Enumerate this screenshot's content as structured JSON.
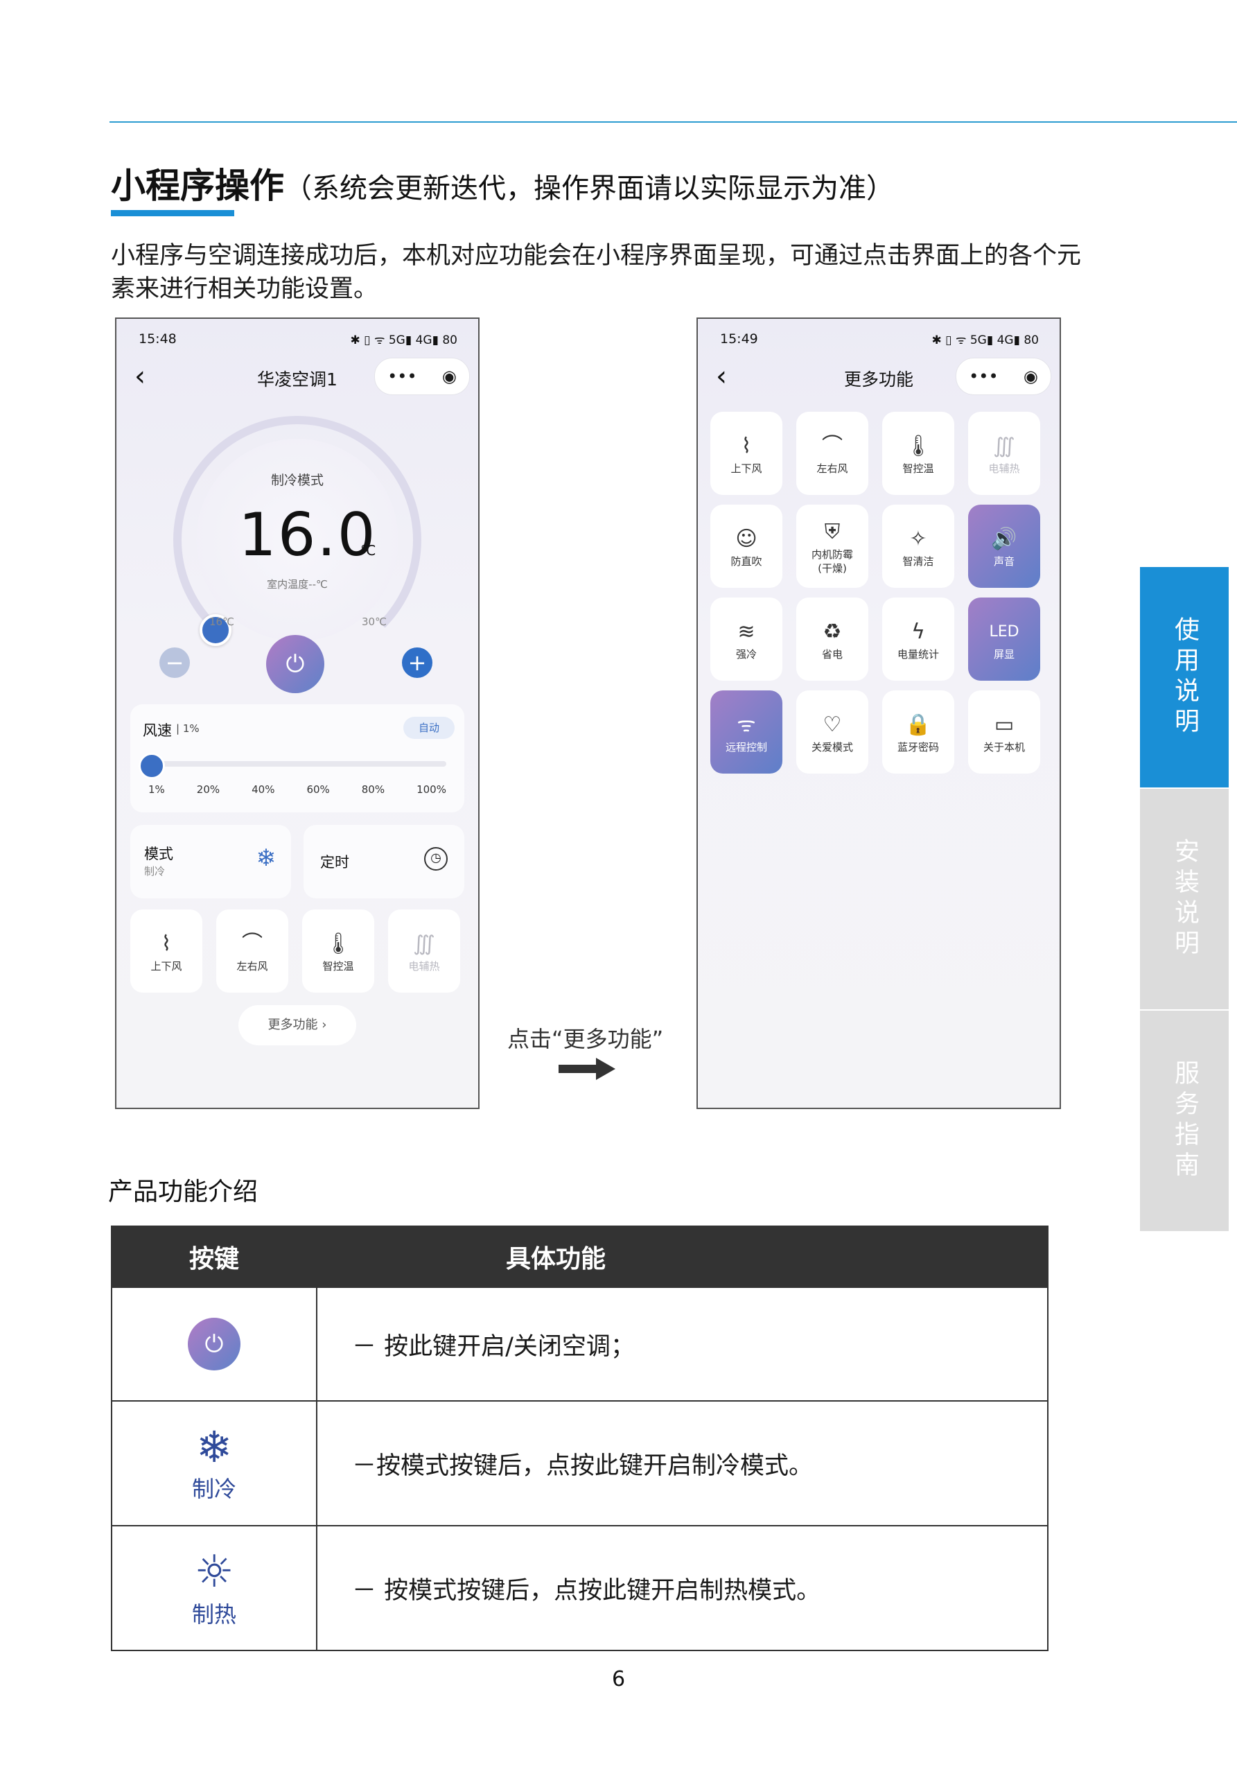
{
  "header": {
    "title": "小程序操作",
    "title_paren_open": "（",
    "title_sub": "系统会更新迭代，操作界面请以实际显示为准",
    "title_paren_close": "）",
    "intro": "小程序与空调连接成功后，本机对应功能会在小程序界面呈现，可通过点击界面上的各个元素来进行相关功能设置。"
  },
  "phone1": {
    "time": "15:48",
    "status_right": "✱ ▯ ᯤ 5G▮ 4G▮ 80",
    "nav_title": "华凌空调1",
    "capsule_more": "•••",
    "capsule_close": "◉",
    "mode_label": "制冷模式",
    "temp_value": "16.0",
    "temp_unit": "℃",
    "indoor_temp": "室内温度--℃",
    "range_min": "16℃",
    "range_max": "30℃",
    "fan_label": "风速",
    "fan_value": "| 1%",
    "fan_auto": "自动",
    "fan_level": 0.01,
    "fan_ticks": [
      "1%",
      "20%",
      "40%",
      "60%",
      "80%",
      "100%"
    ],
    "mode_card_label": "模式",
    "mode_card_value": "制冷",
    "timer_label": "定时",
    "tiles": [
      {
        "label": "上下风",
        "icon": "vertical-swing-icon",
        "glyph": "⌇"
      },
      {
        "label": "左右风",
        "icon": "horizontal-swing-icon",
        "glyph": "⌒"
      },
      {
        "label": "智控温",
        "icon": "thermometer-icon",
        "glyph": "🌡"
      },
      {
        "label": "电辅热",
        "icon": "aux-heat-icon",
        "glyph": "∭"
      }
    ],
    "more_button": "更多功能 ›"
  },
  "arrow_caption": "点击“更多功能”",
  "phone2": {
    "time": "15:49",
    "status_right": "✱ ▯ ᯤ 5G▮ 4G▮ 80",
    "nav_title": "更多功能",
    "capsule_more": "•••",
    "capsule_close": "◉",
    "tiles": [
      {
        "label": "上下风",
        "icon": "vertical-swing-icon",
        "glyph": "⌇",
        "state": "normal"
      },
      {
        "label": "左右风",
        "icon": "horizontal-swing-icon",
        "glyph": "⌒",
        "state": "normal"
      },
      {
        "label": "智控温",
        "icon": "thermometer-icon",
        "glyph": "🌡",
        "state": "normal"
      },
      {
        "label": "电辅热",
        "icon": "aux-heat-icon",
        "glyph": "∭",
        "state": "disabled"
      },
      {
        "label": "防直吹",
        "icon": "anti-direct-blow-icon",
        "glyph": "☺",
        "state": "normal"
      },
      {
        "label": "内机防霉\n(干燥)",
        "icon": "anti-mold-icon",
        "glyph": "⛨",
        "state": "normal"
      },
      {
        "label": "智清洁",
        "icon": "clean-icon",
        "glyph": "✧",
        "state": "normal"
      },
      {
        "label": "声音",
        "icon": "speaker-icon",
        "glyph": "🔊",
        "state": "active"
      },
      {
        "label": "强冷",
        "icon": "strong-cool-icon",
        "glyph": "≋",
        "state": "normal"
      },
      {
        "label": "省电",
        "icon": "eco-icon",
        "glyph": "♻",
        "state": "normal"
      },
      {
        "label": "电量统计",
        "icon": "power-stats-icon",
        "glyph": "ϟ",
        "state": "normal"
      },
      {
        "label": "屏显",
        "icon": "led-icon",
        "glyph": "LED",
        "state": "active"
      },
      {
        "label": "远程控制",
        "icon": "remote-wifi-icon",
        "glyph": "ᯤ",
        "state": "active"
      },
      {
        "label": "关爱模式",
        "icon": "heart-icon",
        "glyph": "♡",
        "state": "normal"
      },
      {
        "label": "蓝牙密码",
        "icon": "lock-icon",
        "glyph": "🔒",
        "state": "normal"
      },
      {
        "label": "关于本机",
        "icon": "ac-unit-icon",
        "glyph": "▭",
        "state": "normal"
      }
    ]
  },
  "section_title": "产品功能介绍",
  "table": {
    "headers": [
      "按键",
      "具体功能"
    ],
    "rows": [
      {
        "key_label": "",
        "icon": "power-icon",
        "desc": "－ 按此键开启/关闭空调；"
      },
      {
        "key_label": "制冷",
        "icon": "snowflake-icon",
        "desc": "－按模式按键后，点按此键开启制冷模式。"
      },
      {
        "key_label": "制热",
        "icon": "sun-icon",
        "desc": "－ 按模式按键后，点按此键开启制热模式。"
      }
    ]
  },
  "side_tabs": [
    {
      "label": "使用说明",
      "active": true
    },
    {
      "label": "安装说明",
      "active": false
    },
    {
      "label": "服务指南",
      "active": false
    }
  ],
  "page_number": "6",
  "colors": {
    "accent_blue": "#1a8fd6",
    "side_active": "#1a8fd6",
    "side_inactive": "#dcdcdc",
    "table_header": "#333333",
    "power_gradient_start": "#b07cc6",
    "power_gradient_end": "#5f82c8"
  }
}
